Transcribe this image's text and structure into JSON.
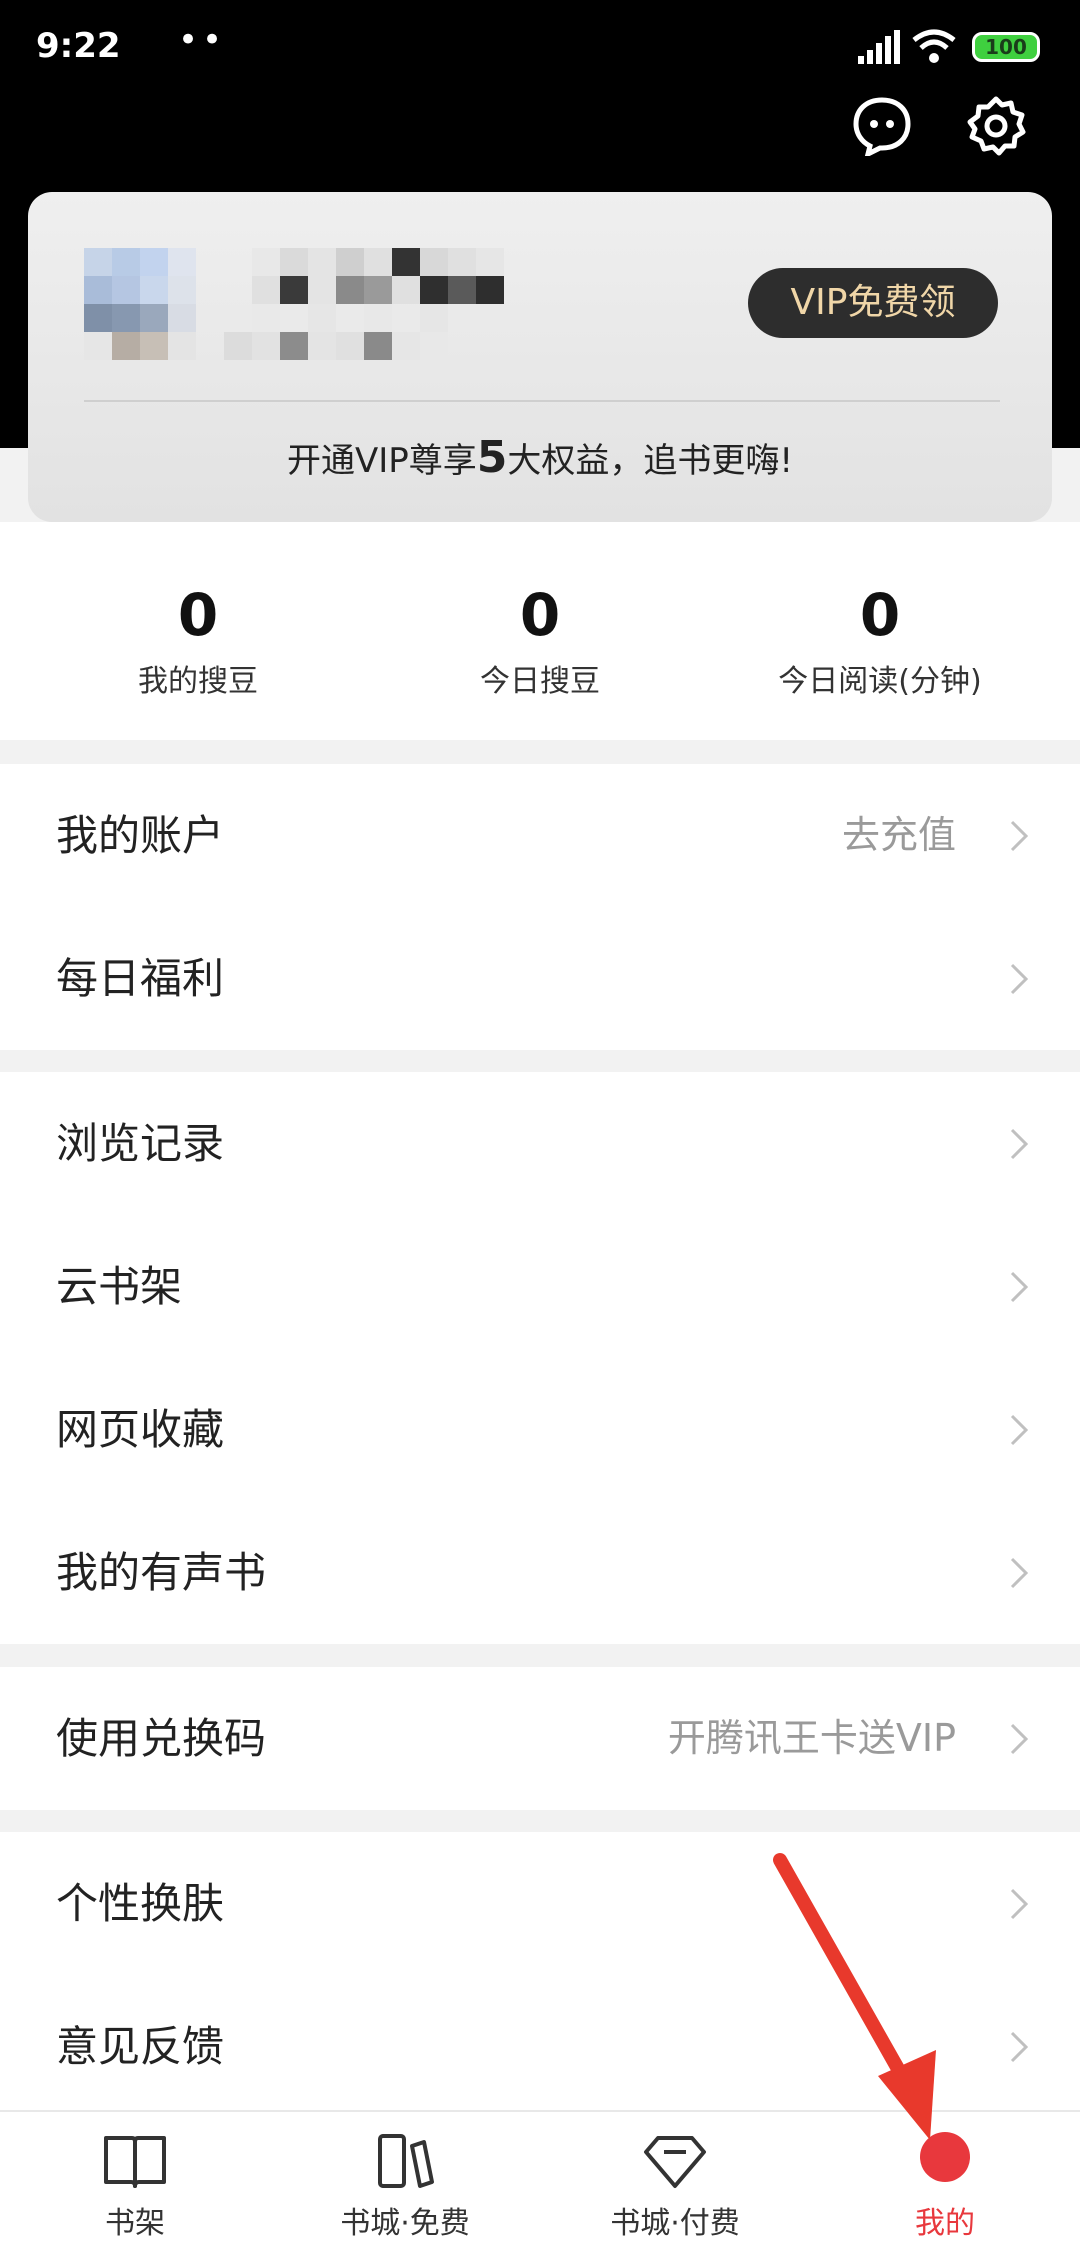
{
  "status_bar": {
    "time": "9:22",
    "dots": "••",
    "battery": "100"
  },
  "profile_card": {
    "vip_button": "VIP免费领",
    "promo_prefix": "开通VIP尊享",
    "promo_number": "5",
    "promo_suffix": "大权益，追书更嗨!"
  },
  "stats": [
    {
      "value": "0",
      "label": "我的搜豆"
    },
    {
      "value": "0",
      "label": "今日搜豆"
    },
    {
      "value": "0",
      "label": "今日阅读(分钟)"
    }
  ],
  "menu": {
    "group1": [
      {
        "label": "我的账户",
        "hint": "去充值"
      },
      {
        "label": "每日福利"
      }
    ],
    "group2": [
      {
        "label": "浏览记录"
      },
      {
        "label": "云书架"
      },
      {
        "label": "网页收藏"
      },
      {
        "label": "我的有声书"
      }
    ],
    "group3": [
      {
        "label": "使用兑换码",
        "hint": "开腾讯王卡送VIP"
      }
    ],
    "group4": [
      {
        "label": "个性换肤"
      },
      {
        "label": "意见反馈"
      }
    ]
  },
  "tab_bar": [
    {
      "label": "书架",
      "icon": "book-open-icon"
    },
    {
      "label": "书城·免费",
      "icon": "books-icon"
    },
    {
      "label": "书城·付费",
      "icon": "diamond-icon"
    },
    {
      "label": "我的",
      "icon": "profile-icon",
      "active": true
    }
  ],
  "colors": {
    "accent": "#e8383d",
    "vip_text": "#f0d6a8",
    "annotation": "#e8392c"
  }
}
